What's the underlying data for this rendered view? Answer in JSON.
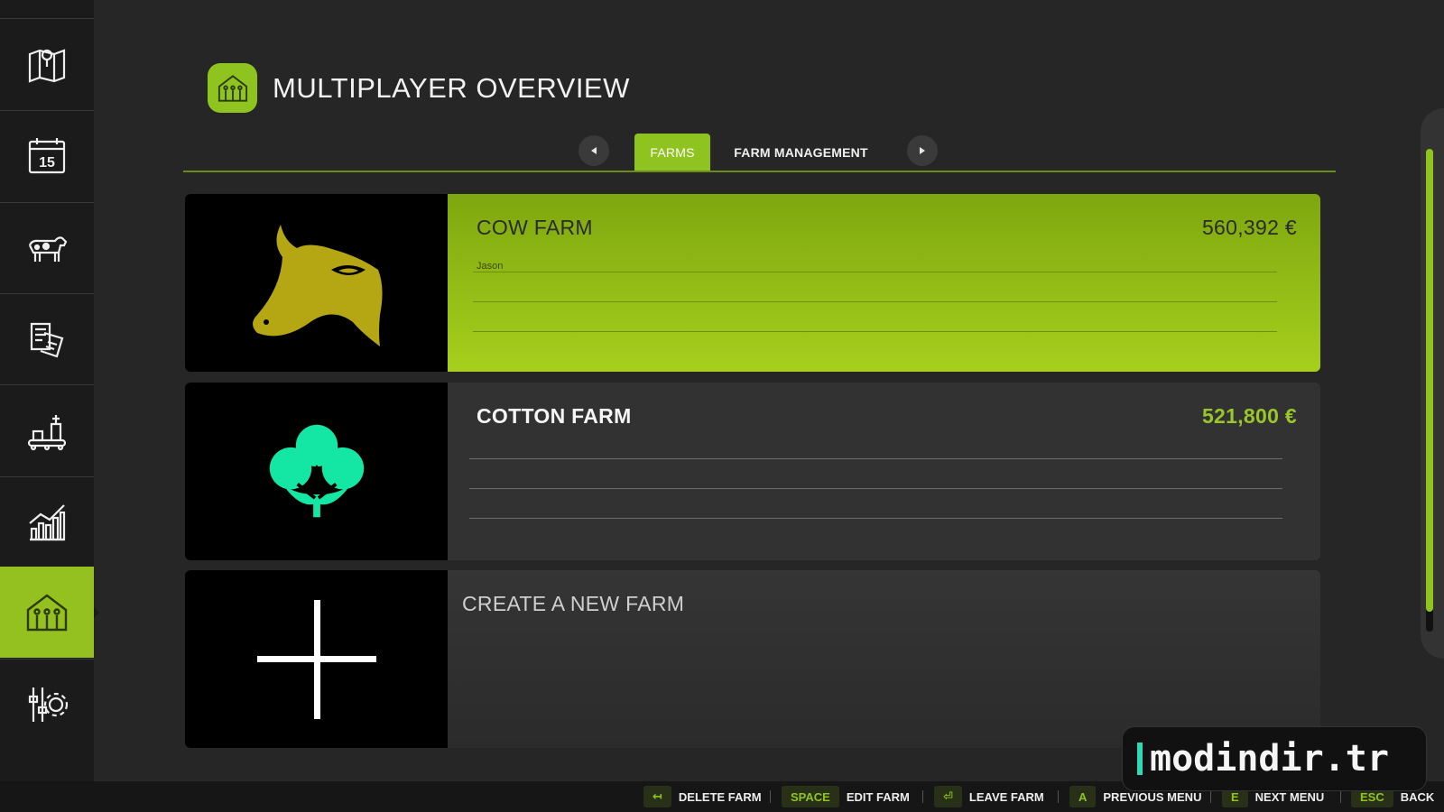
{
  "header": {
    "title": "MULTIPLAYER OVERVIEW",
    "icon": "farm-building-icon"
  },
  "sidebar": {
    "items": [
      {
        "icon": "map-icon"
      },
      {
        "icon": "calendar-icon",
        "day": "15"
      },
      {
        "icon": "cow-icon"
      },
      {
        "icon": "contracts-icon"
      },
      {
        "icon": "production-icon"
      },
      {
        "icon": "statistics-icon"
      },
      {
        "icon": "multiplayer-farm-icon",
        "active": true
      },
      {
        "icon": "settings-icon"
      }
    ]
  },
  "tabs": [
    {
      "label": "FARMS",
      "active": true
    },
    {
      "label": "FARM MANAGEMENT",
      "active": false
    }
  ],
  "farms": [
    {
      "name": "COW FARM",
      "money": "560,392 €",
      "members": [
        "Jason"
      ],
      "icon": "cow-head-icon",
      "selected": true
    },
    {
      "name": "COTTON FARM",
      "money": "521,800 €",
      "members": [],
      "icon": "cotton-icon",
      "selected": false
    }
  ],
  "create": {
    "label": "CREATE A NEW FARM",
    "icon": "plus-icon"
  },
  "footer": {
    "hints": [
      {
        "key": "↤",
        "label": "DELETE FARM"
      },
      {
        "key": "SPACE",
        "label": "EDIT FARM"
      },
      {
        "key": "⏎",
        "label": "LEAVE FARM"
      },
      {
        "key": "A",
        "label": "PREVIOUS MENU"
      },
      {
        "key": "E",
        "label": "NEXT MENU"
      },
      {
        "key": "ESC",
        "label": "BACK"
      }
    ]
  },
  "watermark": "modindir.tr",
  "colors": {
    "accent": "#8fc31f",
    "cow_icon": "#b5a613",
    "cotton_icon": "#14e6a3"
  }
}
